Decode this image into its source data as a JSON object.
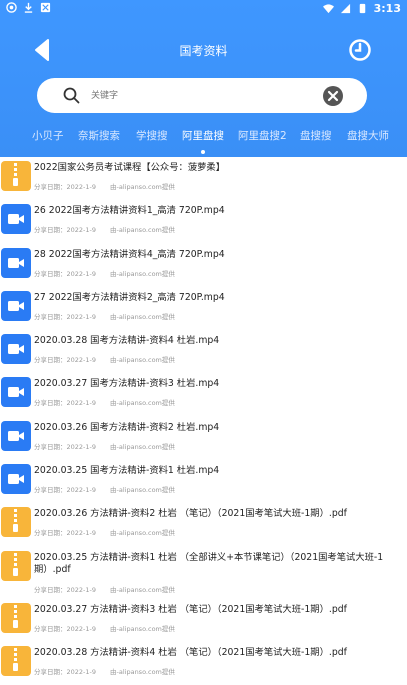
{
  "status_bar": {
    "time": "3:13"
  },
  "header": {
    "title": "国考资料"
  },
  "search": {
    "placeholder": "关键字"
  },
  "tabs": [
    {
      "label": "小贝子"
    },
    {
      "label": "奈斯搜索"
    },
    {
      "label": "学搜搜"
    },
    {
      "label": "阿里盘搜",
      "active": true
    },
    {
      "label": "阿里盘搜2"
    },
    {
      "label": "盘搜搜"
    },
    {
      "label": "盘搜大师"
    }
  ],
  "list": {
    "items": [
      {
        "type": "zip",
        "name": "2022国家公务员考试课程【公众号：菠萝柔】",
        "date": "分享日期：2022-1-9",
        "source": "由-alipanso.com提供"
      },
      {
        "type": "video",
        "name": "26 2022国考方法精讲资料1_高清 720P.mp4",
        "date": "分享日期：2022-1-9",
        "source": "由-alipanso.com提供"
      },
      {
        "type": "video",
        "name": "28 2022国考方法精讲资料4_高清 720P.mp4",
        "date": "分享日期：2022-1-9",
        "source": "由-alipanso.com提供"
      },
      {
        "type": "video",
        "name": "27 2022国考方法精讲资料2_高清 720P.mp4",
        "date": "分享日期：2022-1-9",
        "source": "由-alipanso.com提供"
      },
      {
        "type": "video",
        "name": "2020.03.28 国考方法精讲-资料4 杜岩.mp4",
        "date": "分享日期：2022-1-9",
        "source": "由-alipanso.com提供"
      },
      {
        "type": "video",
        "name": "2020.03.27 国考方法精讲-资料3 杜岩.mp4",
        "date": "分享日期：2022-1-9",
        "source": "由-alipanso.com提供"
      },
      {
        "type": "video",
        "name": "2020.03.26 国考方法精讲-资料2 杜岩.mp4",
        "date": "分享日期：2022-1-9",
        "source": "由-alipanso.com提供"
      },
      {
        "type": "video",
        "name": "2020.03.25 国考方法精讲-资料1 杜岩.mp4",
        "date": "分享日期：2022-1-9",
        "source": "由-alipanso.com提供"
      },
      {
        "type": "zip",
        "name": "2020.03.26 方法精讲-资料2 杜岩 （笔记）（2021国考笔试大班-1期）.pdf",
        "date": "分享日期：2022-1-9",
        "source": "由-alipanso.com提供"
      },
      {
        "type": "zip",
        "name": "2020.03.25 方法精讲-资料1 杜岩 （全部讲义+本节课笔记）（2021国考笔试大班-1期）.pdf",
        "date": "分享日期：2022-1-9",
        "source": "由-alipanso.com提供",
        "tall": true
      },
      {
        "type": "zip",
        "name": "2020.03.27 方法精讲-资料3 杜岩 （笔记）（2021国考笔试大班-1期）.pdf",
        "date": "分享日期：2022-1-9",
        "source": "由-alipanso.com提供"
      },
      {
        "type": "zip",
        "name": "2020.03.28 方法精讲-资料4 杜岩 （笔记）（2021国考笔试大班-1期）.pdf",
        "date": "分享日期：2022-1-9",
        "source": "由-alipanso.com提供"
      }
    ]
  }
}
